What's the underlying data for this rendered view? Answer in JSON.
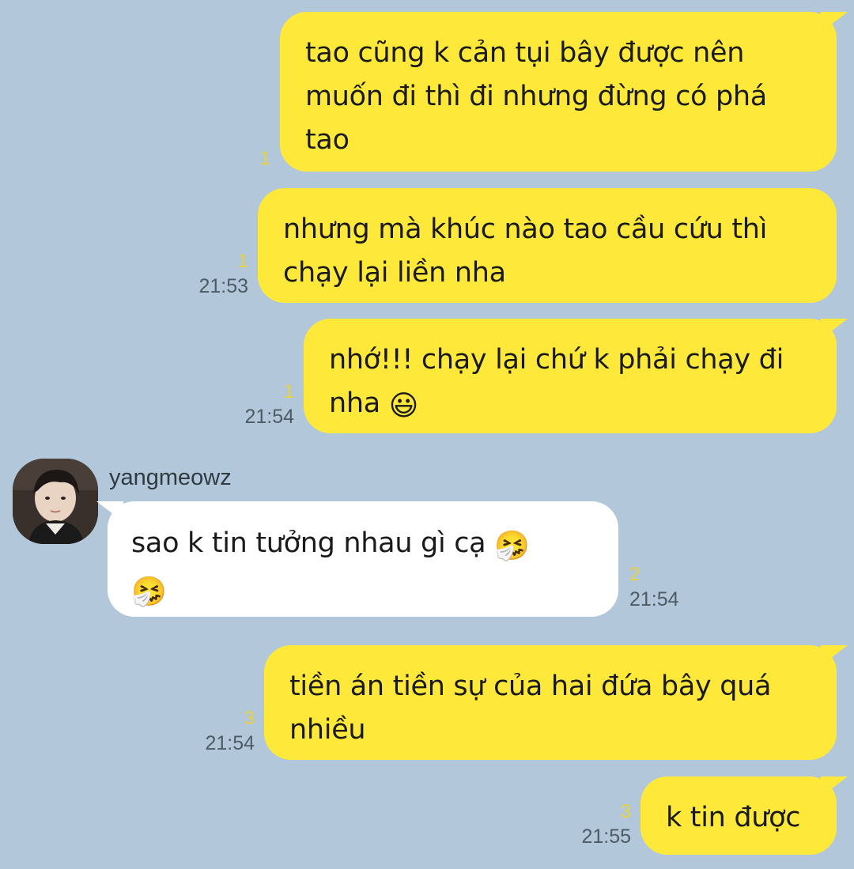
{
  "conversation": {
    "messages": [
      {
        "direction": "out",
        "text": "tao cũng k cản tụi bây được nên muốn đi thì đi nhưng đừng có phá tao",
        "unread": "1",
        "time": ""
      },
      {
        "direction": "out",
        "text": "nhưng mà khúc nào tao cầu cứu thì chạy lại liền nha",
        "unread": "1",
        "time": "21:53"
      },
      {
        "direction": "out",
        "text": "nhớ!!! chạy lại chứ k phải chạy đi nha",
        "emoji": "😃",
        "unread": "1",
        "time": "21:54"
      },
      {
        "direction": "in",
        "sender": "yangmeowz",
        "text": "sao k tin tưởng nhau gì cạ",
        "emoji1": "🤧",
        "emoji2": "🤧",
        "unread": "2",
        "time": "21:54"
      },
      {
        "direction": "out",
        "text": "tiền án tiền sự của hai đứa bây quá nhiều",
        "unread": "3",
        "time": "21:54"
      },
      {
        "direction": "out",
        "text": "k tin được",
        "unread": "3",
        "time": "21:55"
      }
    ]
  },
  "colors": {
    "background": "#b2c7d9",
    "outgoing_bubble": "#fee93b",
    "incoming_bubble": "#ffffff",
    "unread_count": "#e8d23b",
    "timestamp": "#4d5b66"
  },
  "icons": {
    "avatar": "avatar-photo"
  }
}
